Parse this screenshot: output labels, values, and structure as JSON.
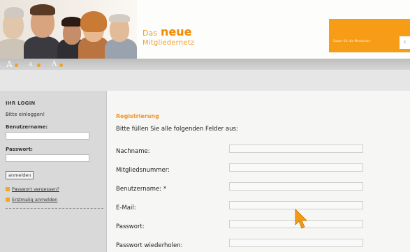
{
  "header": {
    "brand_prefix": "Das",
    "brand_highlight": "neue",
    "brand_suffix": "Mitgliedernetz",
    "slogan": "Sauer für die Menschen",
    "colors": {
      "accent": "#f39a14",
      "brand": "#f08a00"
    }
  },
  "fontbar": {
    "size_small": "A",
    "size_medium": "A",
    "size_large": "A"
  },
  "sidebar": {
    "heading": "IHR LOGIN",
    "prompt": "Bitte einloggen!",
    "username_label": "Benutzername:",
    "username_value": "",
    "password_label": "Passwort:",
    "password_value": "",
    "login_button": "anmelden",
    "links": [
      {
        "label": "Passwort vergessen?"
      },
      {
        "label": "Erstmalig anmelden"
      }
    ]
  },
  "main": {
    "title": "Registrierung",
    "intro": "Bitte füllen Sie alle folgenden Felder aus:",
    "fields": [
      {
        "label": "Nachname:",
        "value": ""
      },
      {
        "label": "Mitgliedsnummer:",
        "value": ""
      },
      {
        "label": "Benutzername: *",
        "value": ""
      },
      {
        "label": "E-Mail:",
        "value": ""
      },
      {
        "label": "Passwort:",
        "value": ""
      },
      {
        "label": "Passwort wiederholen:",
        "value": ""
      }
    ]
  },
  "cursor": {
    "icon": "mouse-pointer-icon",
    "color": "#f39a14"
  }
}
